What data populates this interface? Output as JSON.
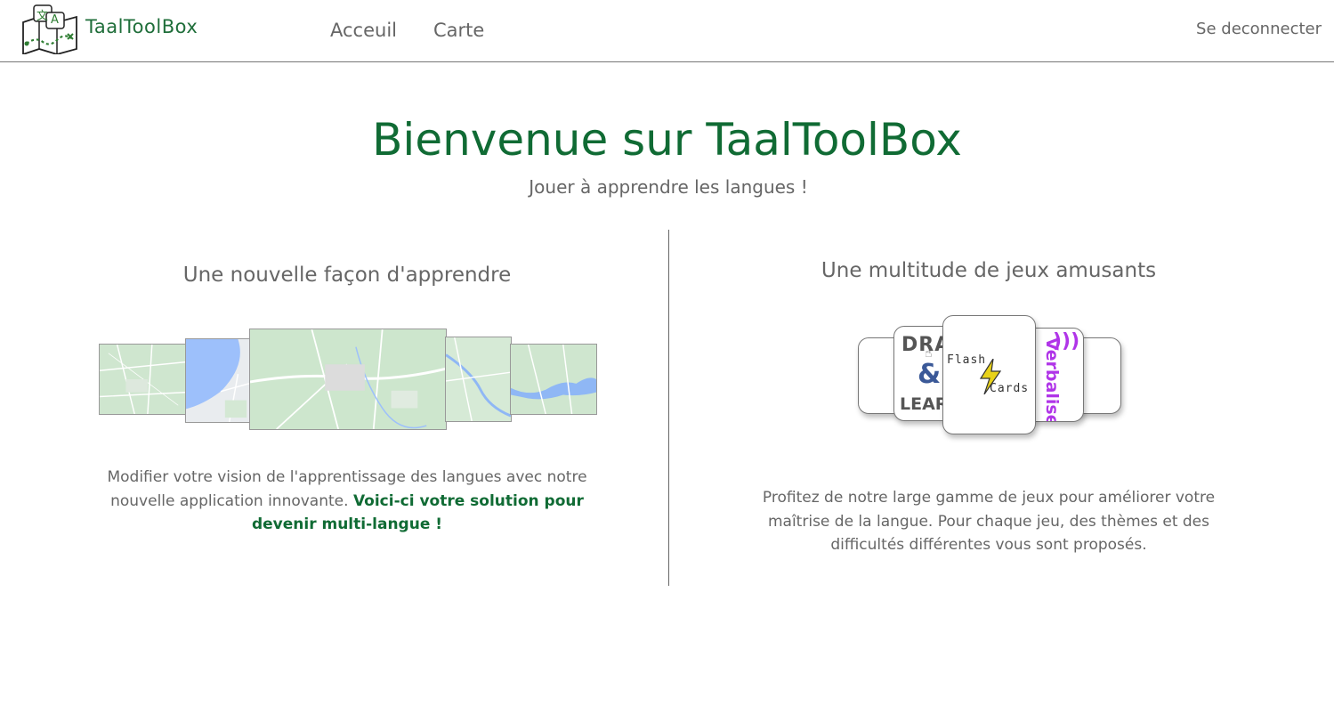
{
  "nav": {
    "brand": "TaalToolBox",
    "links": [
      {
        "label": "Acceuil"
      },
      {
        "label": "Carte"
      }
    ],
    "logout": "Se deconnecter"
  },
  "hero": {
    "title": "Bienvenue sur TaalToolBox",
    "subtitle": "Jouer à apprendre les langues !"
  },
  "left": {
    "title": "Une nouvelle façon d'apprendre",
    "text": "Modifier votre vision de l'apprentissage des langues avec notre nouvelle application innovante. ",
    "highlight": "Voici-ci votre solution pour devenir multi-langue !"
  },
  "right": {
    "title": "Une multitude de jeux amusants",
    "text": "Profitez de notre large gamme de jeux pour améliorer votre maîtrise de la langue. Pour chaque jeu, des thèmes et des difficultés différentes vous sont proposés.",
    "cards": {
      "drag_top": "DRA",
      "drag_amp": "&",
      "drag_bottom": "LEAR",
      "flash_top": "Flash",
      "flash_bottom": "Cards",
      "verbalise": "Verbalise"
    }
  },
  "logo": {
    "glyph_top": "文",
    "glyph_bottom": "A"
  },
  "colors": {
    "brand_green": "#106b34",
    "text_gray": "#666666",
    "verbalise_purple": "#b035e8",
    "flash_yellow": "#e8d21a"
  }
}
